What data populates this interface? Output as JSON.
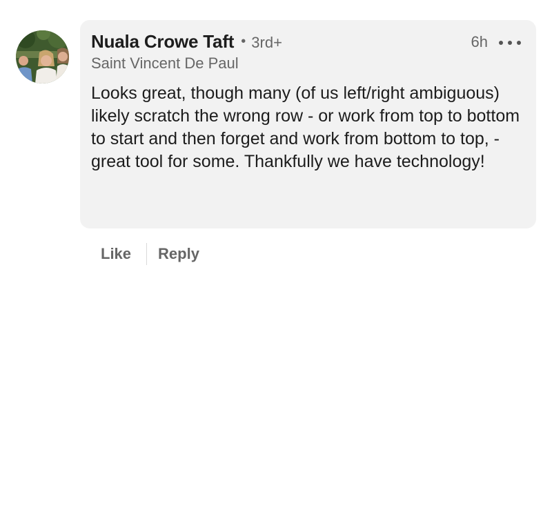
{
  "comment": {
    "author": {
      "name": "Nuala Crowe Taft",
      "separator": "•",
      "degree": "3rd+",
      "headline": "Saint Vincent De Paul",
      "avatar_icon": "profile-photo"
    },
    "time": "6h",
    "more_icon": "ellipsis-icon",
    "text": "Looks great, though many (of us left/right ambiguous) likely scratch the wrong row - or work from top to bottom to start and then forget and work from bottom to top, - great tool for some. Thankfully we have technology!",
    "actions": {
      "like_label": "Like",
      "reply_label": "Reply"
    }
  },
  "colors": {
    "bubble_background": "#f2f2f2",
    "secondary_text": "#666666",
    "primary_text": "#1c1c1c"
  }
}
